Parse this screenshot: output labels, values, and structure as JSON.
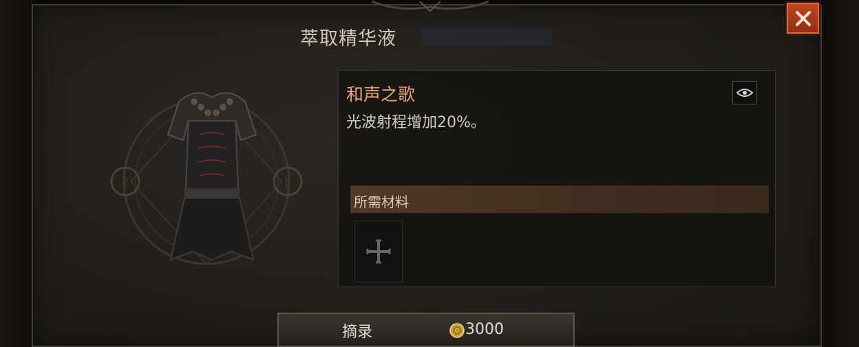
{
  "dialog": {
    "title": "萃取精华液",
    "close_label": "✕"
  },
  "aspect": {
    "name": "和声之歌",
    "description": "光波射程增加20%。"
  },
  "materials": {
    "header": "所需材料"
  },
  "action": {
    "button_label": "摘录",
    "cost": "3000"
  },
  "colors": {
    "accent_orange": "#e8a572",
    "close_red": "#b8401c",
    "panel_bg": "#24211d",
    "materials_bar": "#4a3623"
  },
  "icons": {
    "close": "close-icon",
    "eye": "eye-icon",
    "slot": "cross-icon",
    "coin": "gold-coin-icon",
    "item": "chest-armor-icon"
  }
}
